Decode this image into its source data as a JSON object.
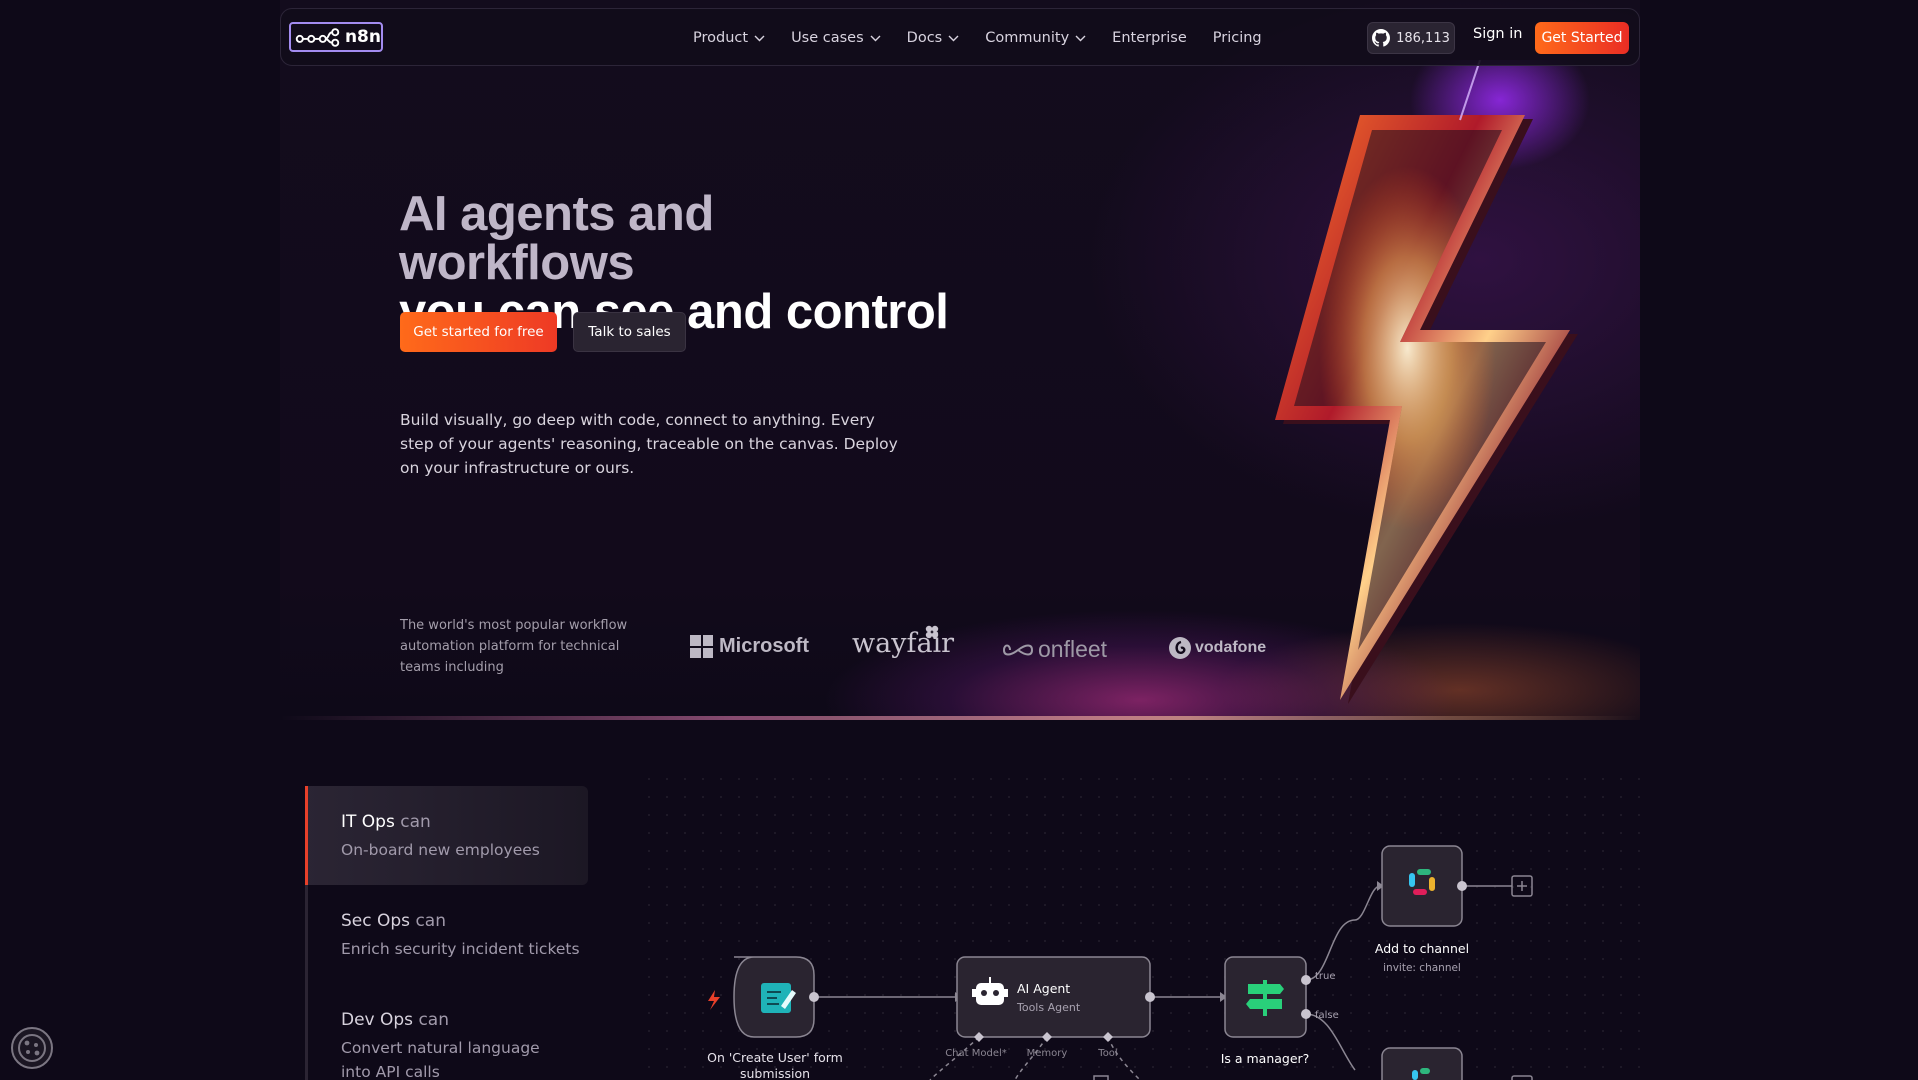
{
  "nav": {
    "logo_text": "n8n",
    "links": [
      {
        "label": "Product",
        "dropdown": true
      },
      {
        "label": "Use cases",
        "dropdown": true
      },
      {
        "label": "Docs",
        "dropdown": true
      },
      {
        "label": "Community",
        "dropdown": true
      },
      {
        "label": "Enterprise",
        "dropdown": false
      },
      {
        "label": "Pricing",
        "dropdown": false
      }
    ],
    "github_stars": "186,113",
    "sign_in": "Sign in",
    "get_started": "Get Started"
  },
  "hero": {
    "headline_line1": "AI agents and workflows",
    "headline_line2": "you can see and control",
    "cta_primary": "Get started for free",
    "cta_secondary": "Talk to sales",
    "subtext": "Build visually, go deep with code, connect to anything. Every step of your agents' reasoning, traceable on the canvas. Deploy on your infrastructure or ours.",
    "trust_text": "The world's most popular workflow automation platform for technical teams including",
    "logos": [
      "Microsoft",
      "wayfair",
      "onfleet",
      "vodafone"
    ]
  },
  "use_cases": [
    {
      "team": "IT Ops",
      "can": "can",
      "desc": "On-board new employees",
      "active": true
    },
    {
      "team": "Sec Ops",
      "can": "can",
      "desc": "Enrich security incident tickets",
      "active": false
    },
    {
      "team": "Dev Ops",
      "can": "can",
      "desc": "Convert natural language into API calls",
      "active": false
    }
  ],
  "workflow": {
    "trigger_label": "On 'Create User' form submission",
    "agent_title": "AI Agent",
    "agent_subtitle": "Tools Agent",
    "agent_ports": [
      "Chat Model*",
      "Memory",
      "Tool"
    ],
    "if_label": "Is a manager?",
    "branch_true": "true",
    "branch_false": "false",
    "slack_label": "Add to channel",
    "slack_sub": "invite: channel"
  },
  "colors": {
    "background": "#0e0918",
    "accent_orange": "#ff6a1a",
    "accent_red": "#ea2d24",
    "logo_border": "#a38cf0",
    "trigger_icon": "#1fb3b8",
    "if_icon": "#29d07a"
  },
  "icons": [
    "n8n-logo-icon",
    "github-icon",
    "chevron-down-icon",
    "form-icon",
    "robot-icon",
    "signpost-icon",
    "slack-icon",
    "plus-icon",
    "cookie-icon",
    "lightning-bolt-icon"
  ]
}
